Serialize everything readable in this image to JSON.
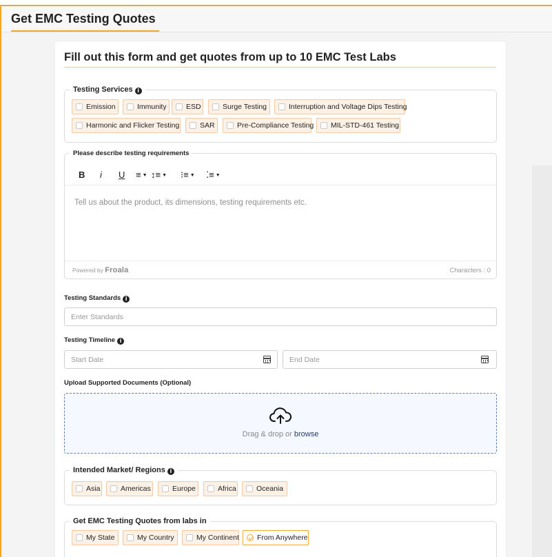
{
  "header": {
    "title": "Get EMC Testing Quotes"
  },
  "form": {
    "title": "Fill out this form and get quotes from up to 10 EMC Test Labs",
    "info_glyph": "i",
    "testing_services": {
      "legend": "Testing Services",
      "options": [
        {
          "label": "Emission",
          "checked": false
        },
        {
          "label": "Immunity",
          "checked": false
        },
        {
          "label": "ESD",
          "checked": false
        },
        {
          "label": "Surge Testing",
          "checked": false
        },
        {
          "label": "Interruption and Voltage Dips Testing",
          "checked": false
        },
        {
          "label": "Harmonic and Flicker Testing",
          "checked": false
        },
        {
          "label": "SAR",
          "checked": false
        },
        {
          "label": "Pre-Compliance Testing",
          "checked": false
        },
        {
          "label": "MIL-STD-461 Testing",
          "checked": false
        }
      ]
    },
    "requirements": {
      "legend": "Please describe testing requirements",
      "toolbar": {
        "bold": "B",
        "italic": "i",
        "underline": "U",
        "align": "≡",
        "line_height": "↕≡",
        "ordered_list": "⁝≡",
        "unordered_list": "⁚≡",
        "caret": "▼"
      },
      "placeholder": "Tell us about the product, its dimensions, testing requirements etc.",
      "powered_by": "Powered by",
      "powered_brand": "Froala",
      "characters": "Characters : 0"
    },
    "standards": {
      "label": "Testing Standards",
      "placeholder": "Enter Standards",
      "value": ""
    },
    "timeline": {
      "label": "Testing Timeline",
      "start_placeholder": "Start Date",
      "end_placeholder": "End Date"
    },
    "upload": {
      "label": "Upload Supported Documents (Optional)",
      "text": "Drag & drop or ",
      "link": "browse"
    },
    "markets": {
      "legend": "Intended Market/ Regions",
      "options": [
        {
          "label": "Asia",
          "checked": false
        },
        {
          "label": "Americas",
          "checked": false
        },
        {
          "label": "Europe",
          "checked": false
        },
        {
          "label": "Africa",
          "checked": false
        },
        {
          "label": "Oceania",
          "checked": false
        }
      ]
    },
    "labs_in": {
      "legend": "Get EMC Testing Quotes from labs in",
      "options": [
        {
          "label": "My State",
          "checked": false
        },
        {
          "label": "My Country",
          "checked": false
        },
        {
          "label": "My Continent",
          "checked": false
        },
        {
          "label": "From Anywhere",
          "checked": true
        }
      ]
    }
  },
  "colors": {
    "accent": "#f5a623",
    "chip_border": "#f2c9a0",
    "chip_fill": "#fcf1e6",
    "dropzone_border": "#5a7fb0",
    "dropzone_fill": "#f5f9ff"
  },
  "icons": {
    "info": "info-circle-icon",
    "calendar": "calendar-icon",
    "upload": "cloud-upload-icon",
    "checkbox": "checkbox-icon"
  }
}
